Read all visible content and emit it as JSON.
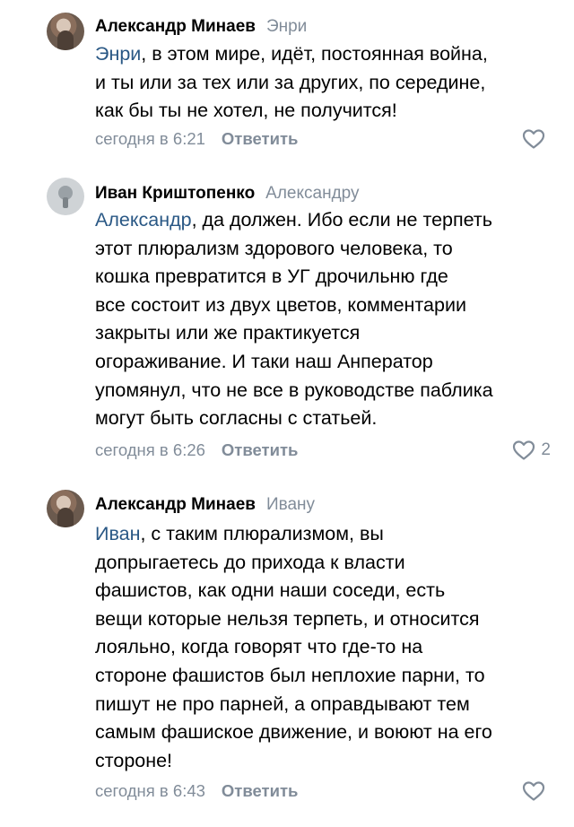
{
  "comments": [
    {
      "author": "Александр Минаев",
      "reply_to": "Энри",
      "mention": "Энри",
      "lines": [
        ", в этом мире, идёт, постоянная война,",
        "и ты или за тех или за других, по середине,",
        "как бы ты не хотел, не получится!"
      ],
      "time": "сегодня в 6:21",
      "reply_label": "Ответить",
      "likes": "",
      "avatar_icon": "user-photo-avatar"
    },
    {
      "author": "Иван Криштопенко",
      "reply_to": "Александру",
      "mention": "Александр",
      "lines": [
        ", да должен. Ибо если не терпеть",
        "этот плюрализм здорового человека, то",
        "кошка превратится в УГ дрочильню где",
        "все состоит из двух цветов, комментарии",
        "закрыты или же практикуется",
        "огораживание. И таки наш Анператор",
        "упомянул, что не все в руководстве паблика",
        "могут быть согласны с статьей."
      ],
      "time": "сегодня в 6:26",
      "reply_label": "Ответить",
      "likes": "2",
      "avatar_icon": "user-default-avatar"
    },
    {
      "author": "Александр Минаев",
      "reply_to": "Ивану",
      "mention": "Иван",
      "lines": [
        ", с таким плюрализмом, вы",
        "допрыгаетесь до прихода к власти",
        "фашистов, как одни наши соседи, есть",
        "вещи которые нельзя терпеть, и относится",
        "лояльно, когда говорят что где-то на",
        "стороне фашистов был неплохие парни, то",
        "пишут не про парней, а оправдывают тем",
        "самым фашиское движение, и воюют на его",
        "стороне!"
      ],
      "time": "сегодня в 6:43",
      "reply_label": "Ответить",
      "likes": "",
      "avatar_icon": "user-photo-avatar"
    }
  ],
  "colors": {
    "mention": "#2a5885",
    "secondary": "#818c99"
  },
  "icons": {
    "like": "heart-outline-icon"
  }
}
